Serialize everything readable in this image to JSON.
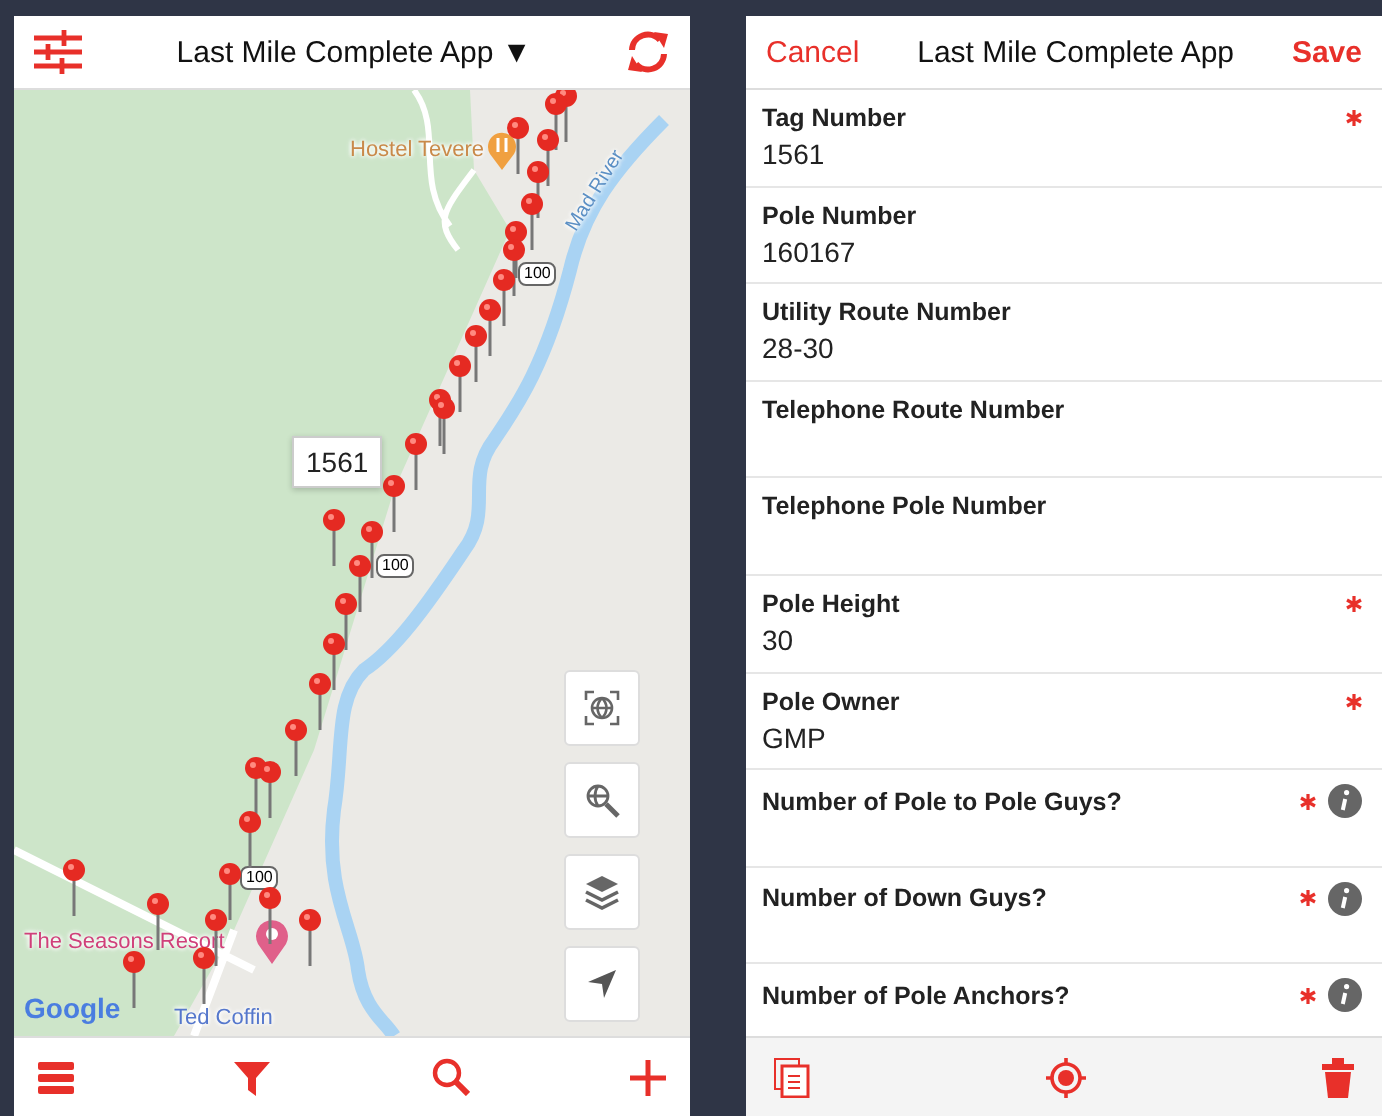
{
  "map_screen": {
    "title": "Last Mile Complete App ▼",
    "map": {
      "labels": [
        {
          "kind": "poi",
          "text": "Hostel Tevere"
        },
        {
          "kind": "river",
          "text": "Mad River"
        },
        {
          "kind": "resort",
          "text": "The Seasons Resort"
        },
        {
          "kind": "street",
          "text": "Ted Coffin"
        }
      ],
      "road_shields": [
        "100",
        "100",
        "100"
      ],
      "callout": "1561",
      "attribution": "Google"
    }
  },
  "form_screen": {
    "cancel": "Cancel",
    "title": "Last Mile Complete App",
    "save": "Save",
    "fields": [
      {
        "label": "Tag Number",
        "value": "1561",
        "required": true,
        "info": false
      },
      {
        "label": "Pole Number",
        "value": "160167",
        "required": false,
        "info": false
      },
      {
        "label": "Utility Route Number",
        "value": "28-30",
        "required": false,
        "info": false
      },
      {
        "label": "Telephone Route Number",
        "required": false,
        "info": false
      },
      {
        "label": "Telephone Pole Number",
        "required": false,
        "info": false
      },
      {
        "label": "Pole Height",
        "value": "30",
        "required": true,
        "info": false
      },
      {
        "label": "Pole Owner",
        "value": "GMP",
        "required": true,
        "info": false
      },
      {
        "label": "Number of Pole to Pole Guys?",
        "required": true,
        "info": true
      },
      {
        "label": "Number of Down Guys?",
        "required": true,
        "info": true
      },
      {
        "label": "Number of Pole Anchors?",
        "required": true,
        "info": true
      }
    ]
  }
}
